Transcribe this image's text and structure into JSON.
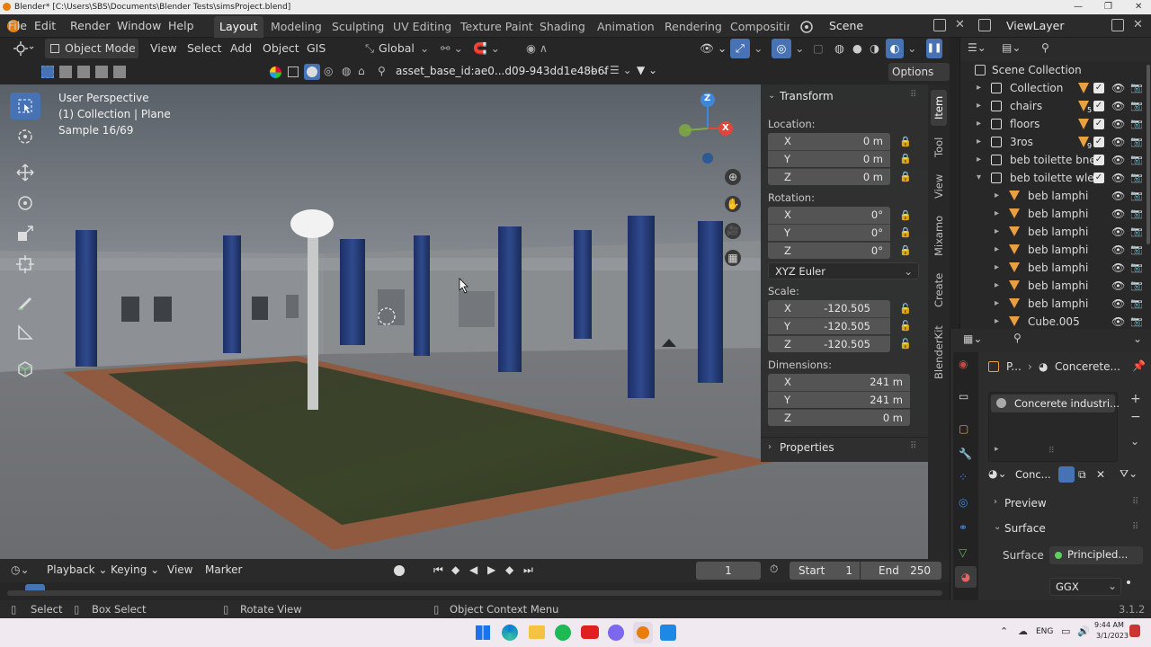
{
  "window": {
    "title": "Blender* [C:\\Users\\SBS\\Documents\\Blender Tests\\simsProject.blend]"
  },
  "menu": [
    "File",
    "Edit",
    "Render",
    "Window",
    "Help"
  ],
  "workspaces": [
    "Layout",
    "Modeling",
    "Sculpting",
    "UV Editing",
    "Texture Paint",
    "Shading",
    "Animation",
    "Rendering",
    "Compositing"
  ],
  "scene": {
    "name": "Scene",
    "view_layer": "ViewLayer"
  },
  "header": {
    "mode": "Object Mode",
    "view": "View",
    "select": "Select",
    "add": "Add",
    "object": "Object",
    "gis": "GIS",
    "orientation": "Global"
  },
  "header2": {
    "asset_search": "asset_base_id:ae0...d09-943dd1e48b6f",
    "options": "Options"
  },
  "viewport": {
    "perspective": "User Perspective",
    "collection": "(1) Collection | Plane",
    "sample": "Sample 16/69",
    "gizmo": {
      "z": "Z",
      "x": "X"
    }
  },
  "npanel": {
    "title": "Transform",
    "location_label": "Location:",
    "location": [
      {
        "axis": "X",
        "value": "0 m"
      },
      {
        "axis": "Y",
        "value": "0 m"
      },
      {
        "axis": "Z",
        "value": "0 m"
      }
    ],
    "rotation_label": "Rotation:",
    "rotation": [
      {
        "axis": "X",
        "value": "0°"
      },
      {
        "axis": "Y",
        "value": "0°"
      },
      {
        "axis": "Z",
        "value": "0°"
      }
    ],
    "rotation_mode": "XYZ Euler",
    "scale_label": "Scale:",
    "scale": [
      {
        "axis": "X",
        "value": "-120.505"
      },
      {
        "axis": "Y",
        "value": "-120.505"
      },
      {
        "axis": "Z",
        "value": "-120.505"
      }
    ],
    "dimensions_label": "Dimensions:",
    "dimensions": [
      {
        "axis": "X",
        "value": "241 m"
      },
      {
        "axis": "Y",
        "value": "241 m"
      },
      {
        "axis": "Z",
        "value": "0 m"
      }
    ],
    "properties": "Properties"
  },
  "ntabs": [
    "Item",
    "Tool",
    "View",
    "Mixamo",
    "Create",
    "BlenderKit"
  ],
  "outliner": {
    "title": "Scene Collection",
    "rows": [
      {
        "name": "Collection",
        "badge": "",
        "type": "collection"
      },
      {
        "name": "chairs",
        "badge": "5",
        "type": "collection"
      },
      {
        "name": "floors",
        "badge": "",
        "type": "collection"
      },
      {
        "name": "3ros",
        "badge": "9",
        "type": "collection"
      },
      {
        "name": "beb toilette bnet",
        "badge": "",
        "type": "collection"
      },
      {
        "name": "beb toilette wled",
        "badge": "",
        "type": "collection"
      },
      {
        "name": "beb lamphi li",
        "badge": "",
        "type": "mesh"
      },
      {
        "name": "beb lamphi li",
        "badge": "",
        "type": "mesh"
      },
      {
        "name": "beb lamphi li",
        "badge": "",
        "type": "mesh"
      },
      {
        "name": "beb lamphi li",
        "badge": "",
        "type": "mesh"
      },
      {
        "name": "beb lamphi li",
        "badge": "",
        "type": "mesh"
      },
      {
        "name": "beb lamphi li",
        "badge": "",
        "type": "mesh"
      },
      {
        "name": "beb lamphi li",
        "badge": "",
        "type": "mesh"
      },
      {
        "name": "Cube.005",
        "badge": "",
        "type": "mesh"
      }
    ]
  },
  "properties": {
    "breadcrumb_obj": "P...",
    "breadcrumb_mat": "Concerete...",
    "slot": "Concerete industri...",
    "mat_name": "Conc...",
    "preview": "Preview",
    "surface_header": "Surface",
    "surface_label": "Surface",
    "surface_value": "Principled...",
    "distribution": "GGX"
  },
  "timeline": {
    "playback": "Playback",
    "keying": "Keying",
    "view": "View",
    "marker": "Marker",
    "current_frame": "1",
    "start_label": "Start",
    "start": "1",
    "end_label": "End",
    "end": "250"
  },
  "status": {
    "select": "Select",
    "box_select": "Box Select",
    "rotate": "Rotate View",
    "context": "Object Context Menu",
    "version": "3.1.2"
  },
  "taskbar": {
    "lang": "ENG",
    "time": "9:44 AM",
    "date": "3/1/2023"
  },
  "colors": {
    "accent": "#4772b3",
    "header": "#262626",
    "panel": "#2d2d2d",
    "field": "#545454",
    "gizmo_x": "#e0453e",
    "gizmo_y": "#7fae3f",
    "gizmo_z": "#3f87db"
  }
}
